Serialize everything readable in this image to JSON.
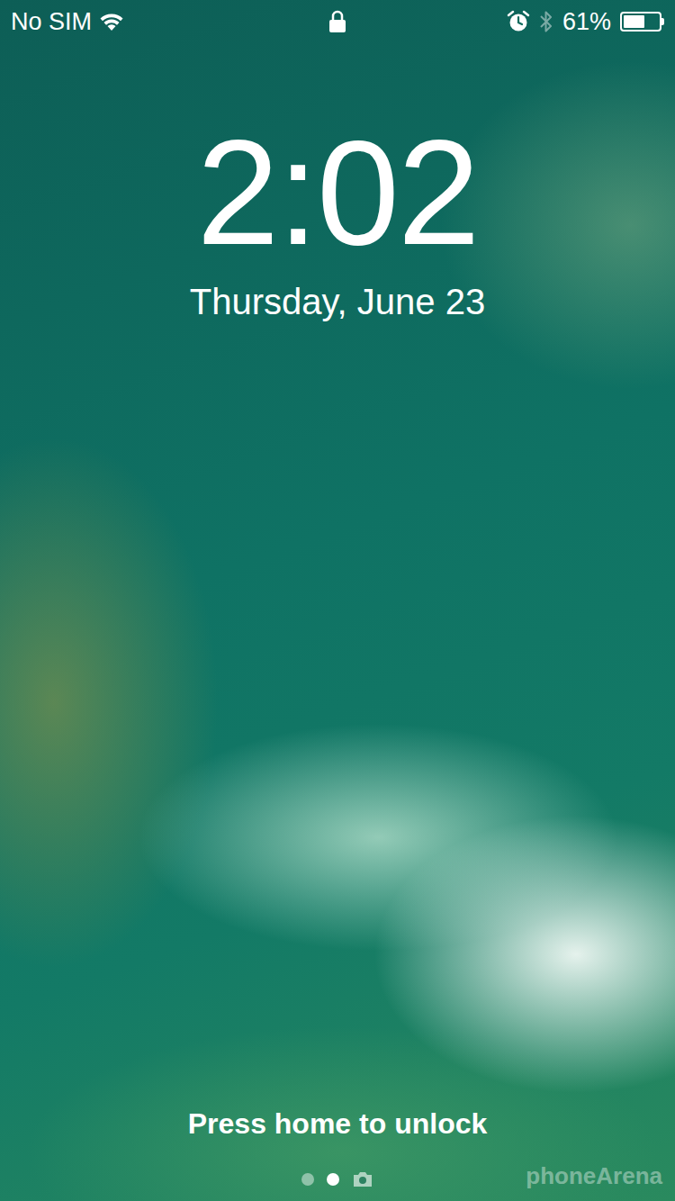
{
  "status_bar": {
    "carrier": "No SIM",
    "wifi": true,
    "locked": true,
    "alarm": true,
    "bluetooth_on": false,
    "battery": "61%",
    "battery_level": 0.61
  },
  "clock": {
    "time": "2:02",
    "date": "Thursday, June 23"
  },
  "unlock_hint": "Press home to unlock",
  "pages": [
    {
      "kind": "dot",
      "selected": false
    },
    {
      "kind": "dot",
      "selected": true
    },
    {
      "kind": "camera",
      "selected": false
    }
  ],
  "watermark": "phoneArena"
}
